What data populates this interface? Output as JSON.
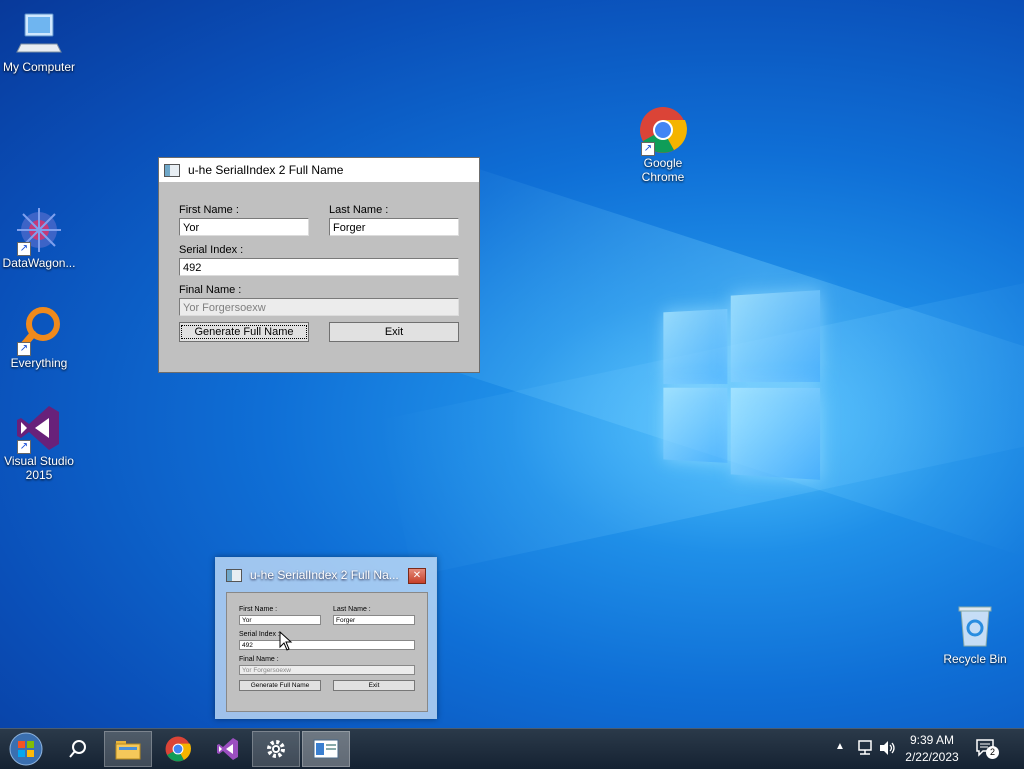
{
  "desktop": {
    "icons": [
      {
        "label": "My Computer"
      },
      {
        "label": "DataWagon..."
      },
      {
        "label": "Everything"
      },
      {
        "label": "Visual Studio 2015"
      },
      {
        "label": "Google Chrome"
      },
      {
        "label": "Recycle Bin"
      }
    ]
  },
  "dialog": {
    "title": "u-he SerialIndex 2 Full Name",
    "first_name_label": "First Name :",
    "first_name_value": "Yor",
    "last_name_label": "Last Name :",
    "last_name_value": "Forger",
    "serial_index_label": "Serial Index :",
    "serial_index_value": "492",
    "final_name_label": "Final Name :",
    "final_name_value": "Yor Forgersoexw",
    "generate_button": "Generate Full Name",
    "exit_button": "Exit"
  },
  "thumbnail": {
    "title": "u-he SerialIndex 2 Full Na...",
    "close_glyph": "✕"
  },
  "taskbar": {
    "clock_time": "9:39 AM",
    "clock_date": "2/22/2023",
    "notification_count": "2"
  }
}
